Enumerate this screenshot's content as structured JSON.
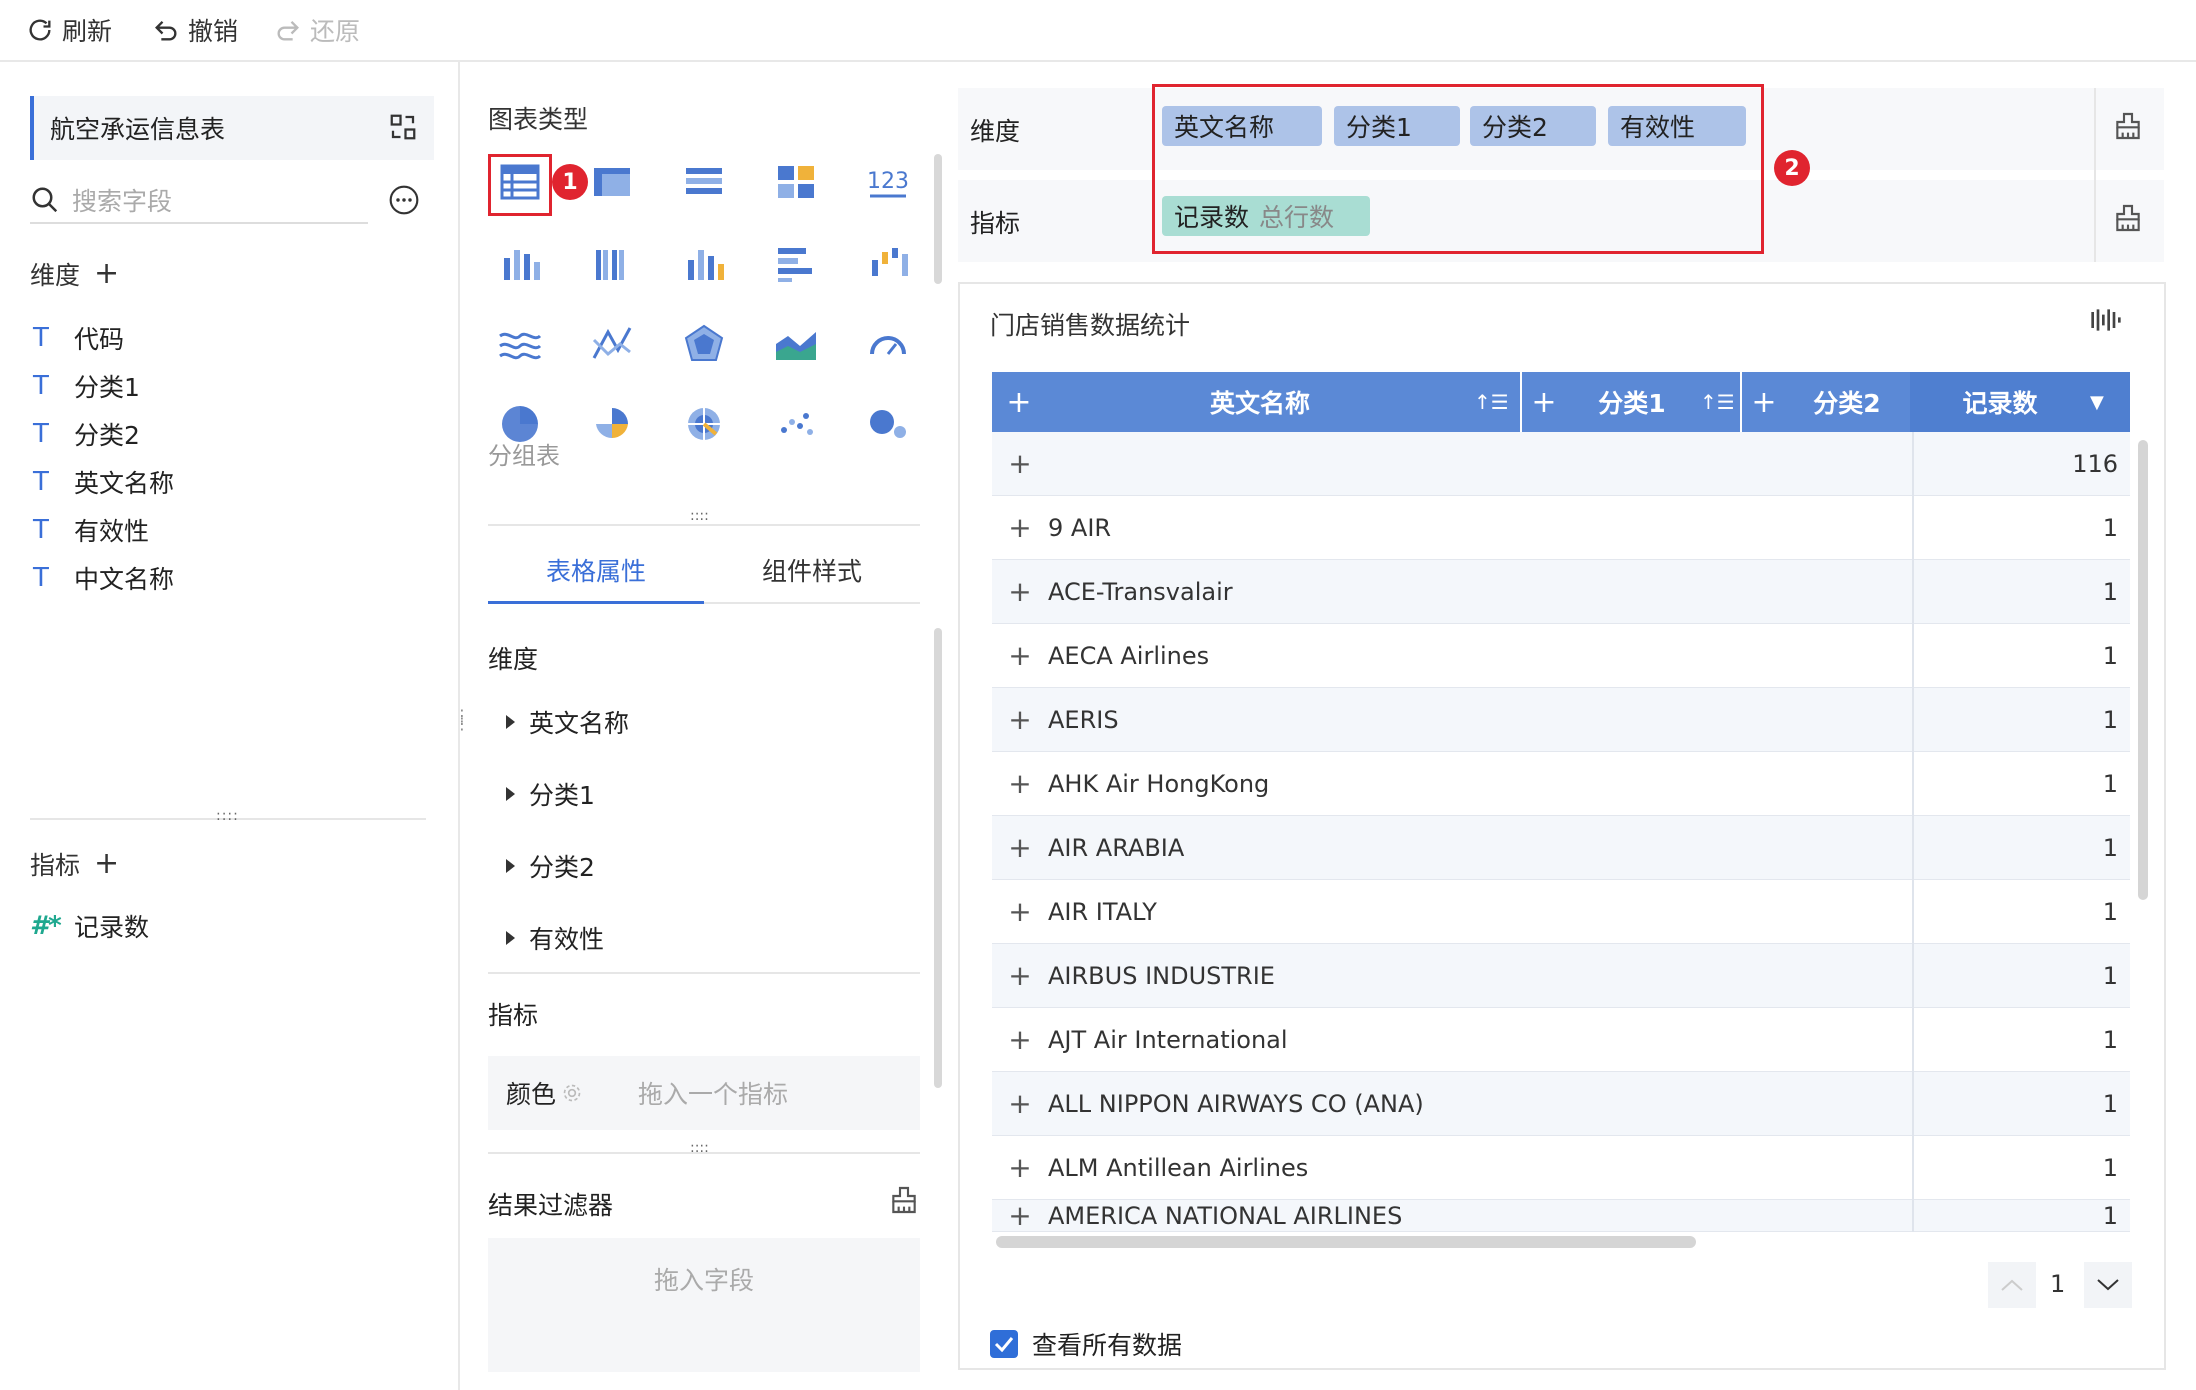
{
  "toolbar": {
    "refresh": "刷新",
    "undo": "撤销",
    "redo": "还原"
  },
  "left": {
    "dataset_title": "航空承运信息表",
    "search_placeholder": "搜索字段",
    "dimensions_label": "维度",
    "dimension_fields": [
      "代码",
      "分类1",
      "分类2",
      "英文名称",
      "有效性",
      "中文名称"
    ],
    "metrics_label": "指标",
    "metric_fields": [
      "记录数"
    ]
  },
  "middle": {
    "chart_type_label": "图表类型",
    "group_table_label": "分组表",
    "tabs": [
      "表格属性",
      "组件样式"
    ],
    "dimension_label": "维度",
    "dimension_items": [
      "英文名称",
      "分类1",
      "分类2",
      "有效性"
    ],
    "metric_label": "指标",
    "color_label": "颜色",
    "color_placeholder": "拖入一个指标",
    "filter_label": "结果过滤器",
    "filter_placeholder": "拖入字段",
    "badge1": "1"
  },
  "right": {
    "dimension_label": "维度",
    "dimension_pills": [
      "英文名称",
      "分类1",
      "分类2",
      "有效性"
    ],
    "metric_label": "指标",
    "metric_pill": "记录数",
    "metric_pill_sub": "总行数",
    "badge2": "2",
    "table_title": "门店销售数据统计",
    "columns": {
      "c1": "英文名称",
      "c2": "分类1",
      "c3": "分类2",
      "c4": "记录数"
    },
    "rows": [
      {
        "name": "",
        "count": "116"
      },
      {
        "name": "9 AIR",
        "count": "1"
      },
      {
        "name": "ACE-Transvalair",
        "count": "1"
      },
      {
        "name": "AECA Airlines",
        "count": "1"
      },
      {
        "name": "AERIS",
        "count": "1"
      },
      {
        "name": "AHK Air HongKong",
        "count": "1"
      },
      {
        "name": "AIR  ARABIA",
        "count": "1"
      },
      {
        "name": "AIR ITALY",
        "count": "1"
      },
      {
        "name": "AIRBUS INDUSTRIE",
        "count": "1"
      },
      {
        "name": "AJT Air International",
        "count": "1"
      },
      {
        "name": "ALL NIPPON AIRWAYS CO (ANA)",
        "count": "1"
      },
      {
        "name": "ALM Antillean Airlines",
        "count": "1"
      },
      {
        "name": "AMERICA NATIONAL AIRLINES",
        "count": "1"
      }
    ],
    "page_number": "1",
    "view_all": "查看所有数据"
  },
  "colors": {
    "accent": "#3a6fd8",
    "header": "#5b89d6",
    "pill_blue": "#adc3e8",
    "pill_green": "#a9ddd3",
    "highlight_red": "#e0242f"
  }
}
